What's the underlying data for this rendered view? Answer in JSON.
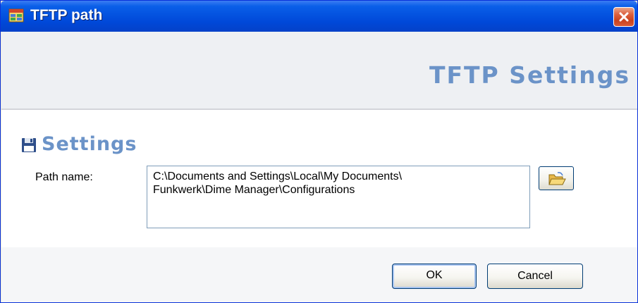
{
  "window": {
    "title": "TFTP path",
    "app_icon": "application-window-icon",
    "close_icon": "close-icon"
  },
  "header": {
    "title": "TFTP Settings"
  },
  "settings": {
    "title": "Settings",
    "icon": "floppy-disk-icon",
    "path_label": "Path name:",
    "path_value": "C:\\Documents and Settings\\Local\\My Documents\\\nFunkwerk\\Dime Manager\\Configurations",
    "browse_icon": "open-folder-icon"
  },
  "buttons": {
    "ok_label": "OK",
    "cancel_label": "Cancel"
  },
  "colors": {
    "titlebar": "#0453e0",
    "accent_text": "#6b93c8",
    "close_button": "#c9421e"
  }
}
